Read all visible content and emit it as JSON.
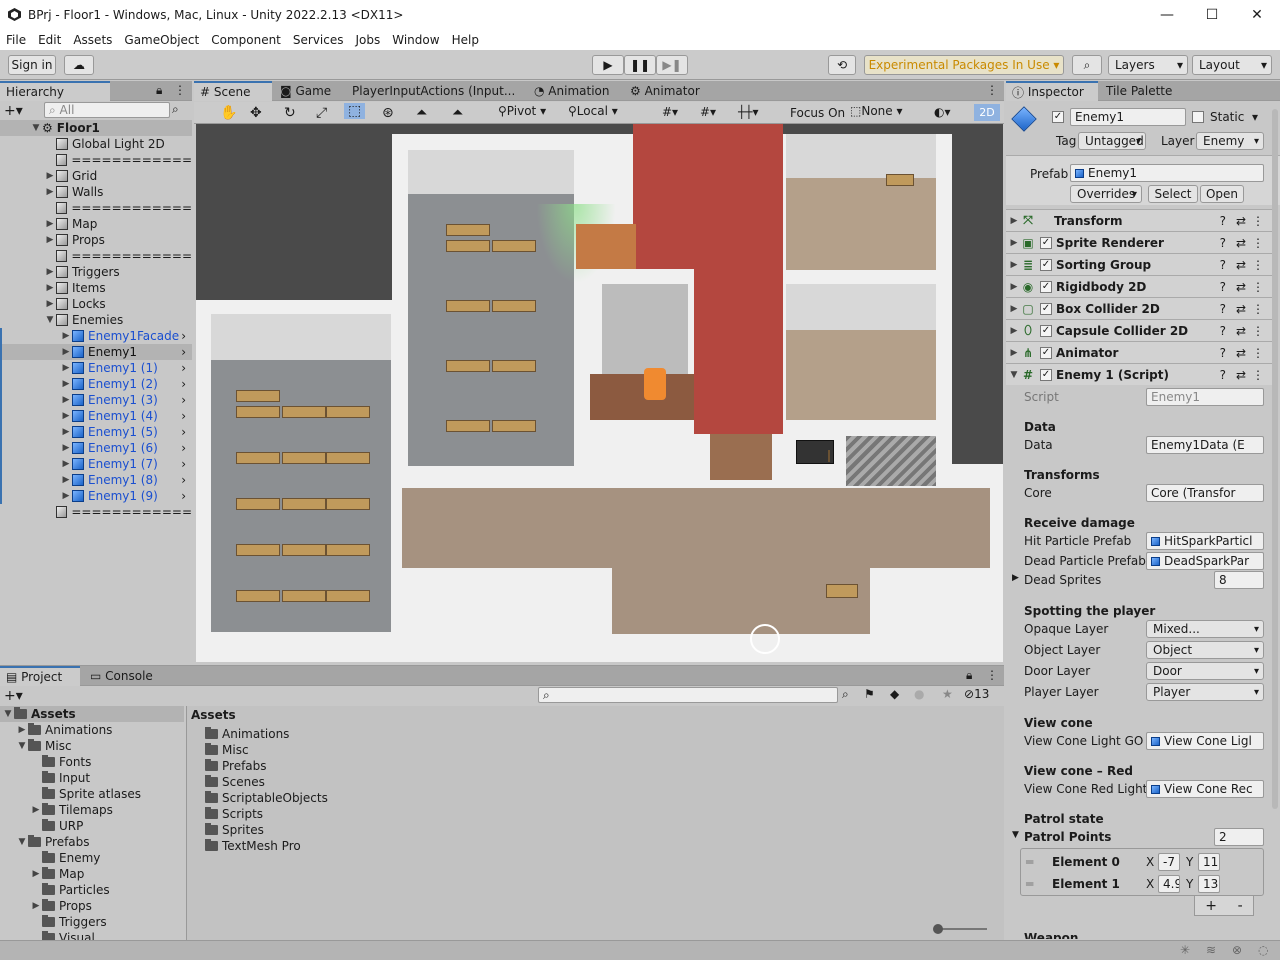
{
  "window": {
    "title": "BPrj - Floor1 - Windows, Mac, Linux - Unity 2022.2.13 <DX11>",
    "min": "—",
    "max": "☐",
    "close": "✕"
  },
  "menu": [
    "File",
    "Edit",
    "Assets",
    "GameObject",
    "Component",
    "Services",
    "Jobs",
    "Window",
    "Help"
  ],
  "toolbar": {
    "sign_in": "Sign in",
    "experimental": "Experimental Packages In Use",
    "layers": "Layers",
    "layout": "Layout"
  },
  "hierarchy": {
    "tab": "Hierarchy",
    "search_placeholder": "All",
    "root": "Floor1",
    "items": [
      {
        "label": "Global Light 2D",
        "arrow": ""
      },
      {
        "label": "============",
        "arrow": ""
      },
      {
        "label": "Grid",
        "arrow": "▶"
      },
      {
        "label": "Walls",
        "arrow": "▶"
      },
      {
        "label": "============",
        "arrow": ""
      },
      {
        "label": "Map",
        "arrow": "▶"
      },
      {
        "label": "Props",
        "arrow": "▶"
      },
      {
        "label": "============",
        "arrow": ""
      },
      {
        "label": "Triggers",
        "arrow": "▶"
      },
      {
        "label": "Items",
        "arrow": "▶"
      },
      {
        "label": "Locks",
        "arrow": "▶"
      },
      {
        "label": "Enemies",
        "arrow": "▼"
      }
    ],
    "enemies": [
      {
        "label": "Enemy1Facade",
        "prefab": true
      },
      {
        "label": "Enemy1",
        "prefab": false
      },
      {
        "label": "Enemy1 (1)",
        "prefab": true
      },
      {
        "label": "Enemy1 (2)",
        "prefab": true
      },
      {
        "label": "Enemy1 (3)",
        "prefab": true
      },
      {
        "label": "Enemy1 (4)",
        "prefab": true
      },
      {
        "label": "Enemy1 (5)",
        "prefab": true
      },
      {
        "label": "Enemy1 (6)",
        "prefab": true
      },
      {
        "label": "Enemy1 (7)",
        "prefab": true
      },
      {
        "label": "Enemy1 (8)",
        "prefab": true
      },
      {
        "label": "Enemy1 (9)",
        "prefab": true
      }
    ],
    "last_sep": "============"
  },
  "scene_tabs": [
    "Scene",
    "Game",
    "PlayerInputActions (Input...",
    "Animation",
    "Animator"
  ],
  "scene_toolbar": {
    "pivot": "Pivot",
    "local": "Local",
    "focus": "Focus On",
    "none": "None",
    "mode2d": "2D"
  },
  "inspector": {
    "tabs": [
      "Inspector",
      "Tile Palette"
    ],
    "name": "Enemy1",
    "static": "Static",
    "tag_label": "Tag",
    "tag": "Untagged",
    "layer_label": "Layer",
    "layer": "Enemy",
    "prefab_label": "Prefab",
    "prefab": "Enemy1",
    "overrides": "Overrides",
    "select": "Select",
    "open": "Open",
    "components": [
      "Transform",
      "Sprite Renderer",
      "Sorting Group",
      "Rigidbody 2D",
      "Box Collider 2D",
      "Capsule Collider 2D",
      "Animator",
      "Enemy 1 (Script)"
    ],
    "script_label": "Script",
    "script": "Enemy1",
    "sections": {
      "data": "Data",
      "transforms": "Transforms",
      "receive": "Receive damage",
      "spotting": "Spotting the player",
      "view_cone": "View cone",
      "view_cone_red": "View cone – Red",
      "patrol": "Patrol state",
      "weapon": "Weapon"
    },
    "fields": {
      "data_label": "Data",
      "data_value": "Enemy1Data (E",
      "core_label": "Core",
      "core_value": "Core (Transfor",
      "hit_label": "Hit Particle Prefab",
      "hit_value": "HitSparkParticl",
      "dead_label": "Dead Particle Prefab",
      "dead_value": "DeadSparkPar",
      "sprites_label": "Dead Sprites",
      "sprites_value": "8",
      "opaque_label": "Opaque Layer",
      "opaque_value": "Mixed...",
      "object_label": "Object Layer",
      "object_value": "Object",
      "door_label": "Door Layer",
      "door_value": "Door",
      "player_label": "Player Layer",
      "player_value": "Player",
      "cone_label": "View Cone Light GO",
      "cone_value": "View Cone Ligl",
      "cone_red_label": "View Cone Red Light",
      "cone_red_value": "View Cone Rec",
      "patrol_label": "Patrol Points",
      "patrol_value": "2",
      "el0_label": "Element 0",
      "el0_x": "-7",
      "el0_y": "11",
      "el1_label": "Element 1",
      "el1_x": "4.9",
      "el1_y": "13",
      "x": "X",
      "y": "Y",
      "plus": "+",
      "minus": "-"
    }
  },
  "project": {
    "tabs": [
      "Project",
      "Console"
    ],
    "hidden_count": "13",
    "tree": [
      {
        "label": "Assets",
        "indent": 0,
        "arrow": "▼",
        "bold": true
      },
      {
        "label": "Animations",
        "indent": 1,
        "arrow": "▶"
      },
      {
        "label": "Misc",
        "indent": 1,
        "arrow": "▼"
      },
      {
        "label": "Fonts",
        "indent": 2,
        "arrow": ""
      },
      {
        "label": "Input",
        "indent": 2,
        "arrow": ""
      },
      {
        "label": "Sprite atlases",
        "indent": 2,
        "arrow": ""
      },
      {
        "label": "Tilemaps",
        "indent": 2,
        "arrow": "▶"
      },
      {
        "label": "URP",
        "indent": 2,
        "arrow": ""
      },
      {
        "label": "Prefabs",
        "indent": 1,
        "arrow": "▼"
      },
      {
        "label": "Enemy",
        "indent": 2,
        "arrow": ""
      },
      {
        "label": "Map",
        "indent": 2,
        "arrow": "▶"
      },
      {
        "label": "Particles",
        "indent": 2,
        "arrow": ""
      },
      {
        "label": "Props",
        "indent": 2,
        "arrow": "▶"
      },
      {
        "label": "Triggers",
        "indent": 2,
        "arrow": ""
      },
      {
        "label": "Visual",
        "indent": 2,
        "arrow": ""
      }
    ],
    "breadcrumb": "Assets",
    "folders": [
      "Animations",
      "Misc",
      "Prefabs",
      "Scenes",
      "ScriptableObjects",
      "Scripts",
      "Sprites",
      "TextMesh Pro"
    ]
  }
}
